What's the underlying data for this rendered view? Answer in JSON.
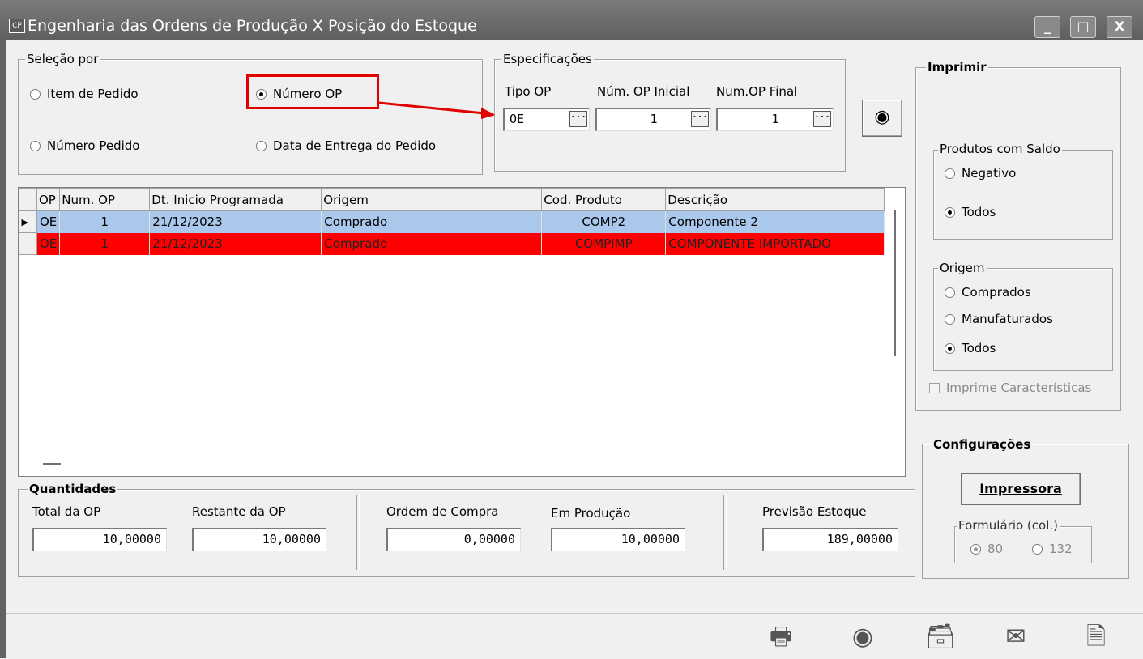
{
  "window": {
    "title": "Engenharia das Ordens de Produção X Posição do Estoque",
    "app_icon_text": "CP",
    "minimize": "_",
    "maximize": "□",
    "close": "X"
  },
  "selecao": {
    "legend": "Seleção por",
    "options": [
      {
        "label": "Item de Pedido",
        "checked": false
      },
      {
        "label": "Número OP",
        "checked": true
      },
      {
        "label": "Número Pedido",
        "checked": false
      },
      {
        "label": "Data de Entrega do Pedido",
        "checked": false
      }
    ]
  },
  "especificacoes": {
    "legend": "Especificações",
    "tipo_op": {
      "label": "Tipo OP",
      "value": "OE"
    },
    "num_op_inicial": {
      "label": "Núm. OP Inicial",
      "value": "1"
    },
    "num_op_final": {
      "label": "Num.OP Final",
      "value": "1"
    },
    "dropdown_glyph": "···"
  },
  "grid": {
    "columns": [
      "OP",
      "Num. OP",
      "Dt. Inicio Programada",
      "Origem",
      "Cod. Produto",
      "Descrição"
    ],
    "rows": [
      {
        "op": "OE",
        "num": "1",
        "dt": "21/12/2023",
        "origem": "Comprado",
        "cod": "COMP2",
        "desc": "Componente 2",
        "style": "sel",
        "current": true
      },
      {
        "op": "OE",
        "num": "1",
        "dt": "21/12/2023",
        "origem": "Comprado",
        "cod": "COMPIMP",
        "desc": "COMPONENTE IMPORTADO",
        "style": "red",
        "current": false
      }
    ]
  },
  "quantidades": {
    "legend": "Quantidades",
    "total_op": {
      "label": "Total da OP",
      "value": "10,00000"
    },
    "restante_op": {
      "label": "Restante da OP",
      "value": "10,00000"
    },
    "ordem_compra": {
      "label": "Ordem de Compra",
      "value": "0,00000"
    },
    "em_producao": {
      "label": "Em Produção",
      "value": "10,00000"
    },
    "previsao_estoque": {
      "label": "Previsão Estoque",
      "value": "189,00000"
    }
  },
  "imprimir": {
    "legend": "Imprimir",
    "saldo": {
      "legend": "Produtos com Saldo",
      "options": [
        {
          "label": "Negativo",
          "checked": false
        },
        {
          "label": "Todos",
          "checked": true
        }
      ]
    },
    "origem": {
      "legend": "Origem",
      "options": [
        {
          "label": "Comprados",
          "checked": false
        },
        {
          "label": "Manufaturados",
          "checked": false
        },
        {
          "label": "Todos",
          "checked": true
        }
      ]
    },
    "imprime_caracteristicas": "Imprime Características"
  },
  "configuracoes": {
    "legend": "Configurações",
    "impressora_label": "Impressora",
    "formulario": {
      "legend": "Formulário (col.)",
      "options": [
        {
          "label": "80",
          "checked": true
        },
        {
          "label": "132",
          "checked": false
        }
      ]
    }
  },
  "toolbar": {
    "icons": [
      "printer-icon",
      "eye-icon",
      "tray-icon",
      "envelope-icon",
      "document-close-icon"
    ],
    "glyphs": [
      "🖶",
      "◉",
      "🗃",
      "✉",
      "🗎"
    ]
  },
  "annotation_color": "#e00000"
}
